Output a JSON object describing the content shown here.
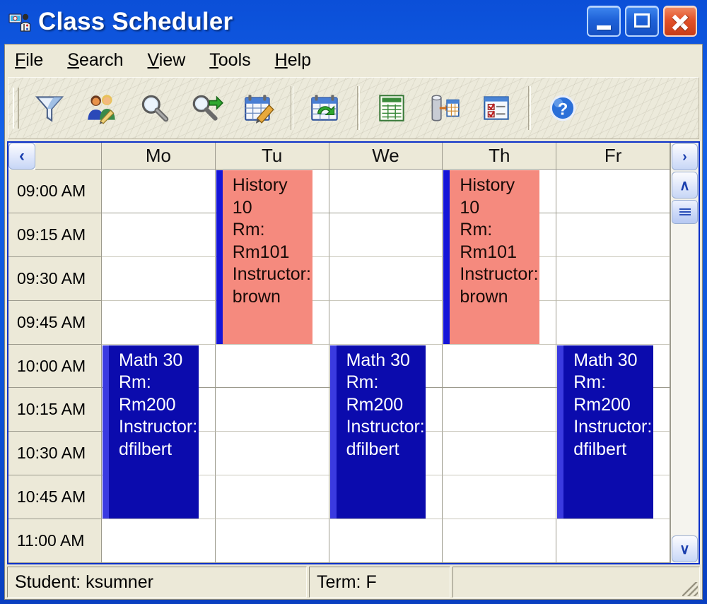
{
  "window": {
    "title": "Class Scheduler",
    "icon": "app-person-screen-icon",
    "buttons": {
      "minimize": "minimize-button",
      "maximize": "maximize-button",
      "close": "close-button"
    }
  },
  "menubar": {
    "items": [
      {
        "label": "File",
        "mnemonic": "F"
      },
      {
        "label": "Search",
        "mnemonic": "S"
      },
      {
        "label": "View",
        "mnemonic": "V"
      },
      {
        "label": "Tools",
        "mnemonic": "T"
      },
      {
        "label": "Help",
        "mnemonic": "H"
      }
    ]
  },
  "toolbar": {
    "buttons": [
      {
        "icon": "filter-funnel-icon"
      },
      {
        "icon": "edit-students-icon"
      },
      {
        "icon": "search-magnifier-icon"
      },
      {
        "icon": "search-next-magnifier-icon"
      },
      {
        "icon": "edit-schedule-calendar-icon"
      },
      {
        "icon": "refresh-schedule-calendar-icon"
      },
      {
        "icon": "report-grid-icon"
      },
      {
        "icon": "export-database-table-icon"
      },
      {
        "icon": "checklist-form-icon"
      },
      {
        "icon": "help-question-icon"
      }
    ]
  },
  "schedule": {
    "nav": {
      "prev": "‹",
      "next": "›"
    },
    "days": [
      "Mo",
      "Tu",
      "We",
      "Th",
      "Fr"
    ],
    "times": [
      "09:00 AM",
      "09:15 AM",
      "09:30 AM",
      "09:45 AM",
      "10:00 AM",
      "10:15 AM",
      "10:30 AM",
      "10:45 AM",
      "11:00 AM"
    ],
    "events": [
      {
        "title": "History 10",
        "room_label": "Rm:",
        "room": "Rm101",
        "instructor_label": "Instructor:",
        "instructor": "brown",
        "day": "Tu",
        "start": "09:00 AM",
        "end": "10:00 AM",
        "color": "#f58a7e",
        "accent": "#1515d8",
        "text": "History 10\nRm:\nRm101\nInstructor:\nbrown"
      },
      {
        "title": "History 10",
        "room_label": "Rm:",
        "room": "Rm101",
        "instructor_label": "Instructor:",
        "instructor": "brown",
        "day": "Th",
        "start": "09:00 AM",
        "end": "10:00 AM",
        "color": "#f58a7e",
        "accent": "#1515d8",
        "text": "History 10\nRm:\nRm101\nInstructor:\nbrown"
      },
      {
        "title": "Math 30",
        "room_label": "Rm:",
        "room": "Rm200",
        "instructor_label": "Instructor:",
        "instructor": "dfilbert",
        "day": "Mo",
        "start": "10:00 AM",
        "end": "11:00 AM",
        "color": "#0b0bad",
        "accent": "#3a3ae0",
        "text": "Math 30\nRm:\nRm200\nInstructor:\ndfilbert"
      },
      {
        "title": "Math 30",
        "room_label": "Rm:",
        "room": "Rm200",
        "instructor_label": "Instructor:",
        "instructor": "dfilbert",
        "day": "We",
        "start": "10:00 AM",
        "end": "11:00 AM",
        "color": "#0b0bad",
        "accent": "#3a3ae0",
        "text": "Math 30\nRm:\nRm200\nInstructor:\ndfilbert"
      },
      {
        "title": "Math 30",
        "room_label": "Rm:",
        "room": "Rm200",
        "instructor_label": "Instructor:",
        "instructor": "dfilbert",
        "day": "Fr",
        "start": "10:00 AM",
        "end": "11:00 AM",
        "color": "#0b0bad",
        "accent": "#3a3ae0",
        "text": "Math 30\nRm:\nRm200\nInstructor:\ndfilbert"
      }
    ],
    "scrollbar": {
      "up": "∧",
      "down": "∨"
    }
  },
  "statusbar": {
    "student": "Student: ksumner",
    "term": "Term: F",
    "extra": ""
  },
  "colors": {
    "titlebar_blue": "#0b4fd8",
    "face": "#ece9d8",
    "history_fill": "#f58a7e",
    "math_fill": "#0b0bad",
    "grid_line": "#9c9a8d"
  }
}
